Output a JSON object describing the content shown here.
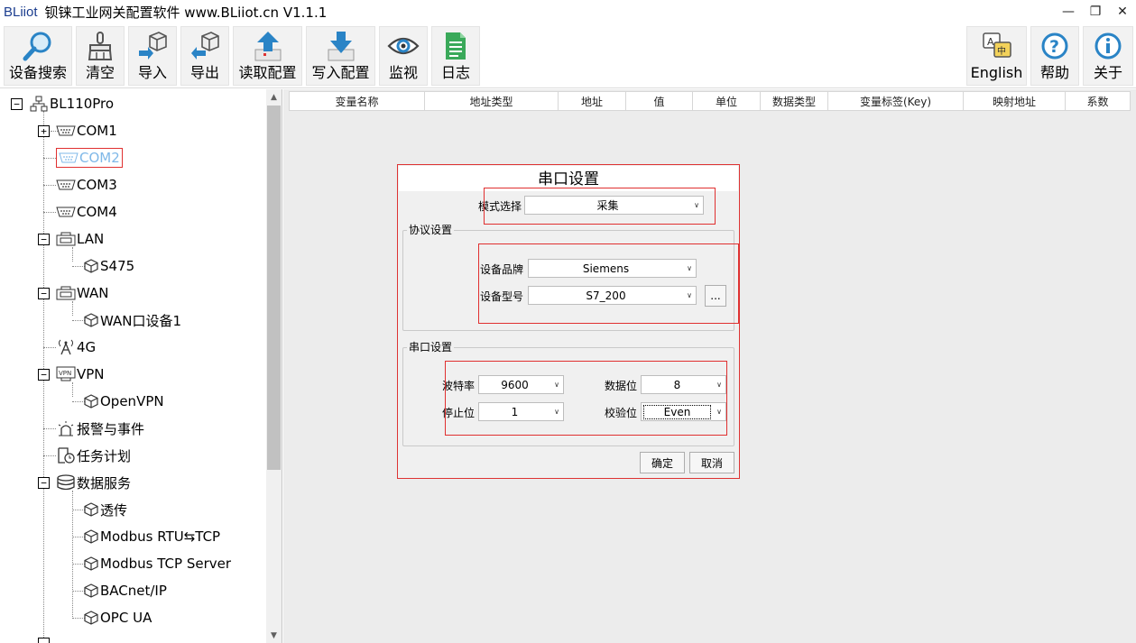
{
  "window": {
    "logo": "BLiiot",
    "title": "钡铼工业网关配置软件 www.BLiiot.cn V1.1.1",
    "minimize": "—",
    "restore": "❐",
    "close": "✕"
  },
  "toolbar": {
    "left": [
      {
        "label": "设备搜索",
        "icon": "magnifier-icon"
      },
      {
        "label": "清空",
        "icon": "broom-icon"
      },
      {
        "label": "导入",
        "icon": "import-box-icon"
      },
      {
        "label": "导出",
        "icon": "export-box-icon"
      },
      {
        "label": "读取配置",
        "icon": "upload-arrow-icon"
      },
      {
        "label": "写入配置",
        "icon": "download-arrow-icon"
      },
      {
        "label": "监视",
        "icon": "eye-icon"
      },
      {
        "label": "日志",
        "icon": "log-document-icon"
      }
    ],
    "right": [
      {
        "label": "English",
        "icon": "language-icon"
      },
      {
        "label": "帮助",
        "icon": "help-icon"
      },
      {
        "label": "关于",
        "icon": "info-icon"
      }
    ]
  },
  "tree": {
    "root": "BL110Pro",
    "items": [
      {
        "label": "COM1",
        "icon": "serial-port-icon"
      },
      {
        "label": "COM2",
        "icon": "serial-port-icon"
      },
      {
        "label": "COM3",
        "icon": "serial-port-icon"
      },
      {
        "label": "COM4",
        "icon": "serial-port-icon"
      },
      {
        "label": "LAN",
        "icon": "lan-port-icon"
      },
      {
        "label": "S475",
        "icon": "device-cube-icon"
      },
      {
        "label": "WAN",
        "icon": "wan-port-icon"
      },
      {
        "label": "WAN口设备1",
        "icon": "device-cube-icon"
      },
      {
        "label": "4G",
        "icon": "antenna-icon"
      },
      {
        "label": "VPN",
        "icon": "vpn-icon"
      },
      {
        "label": "OpenVPN",
        "icon": "device-cube-icon"
      },
      {
        "label": "报警与事件",
        "icon": "alarm-icon"
      },
      {
        "label": "任务计划",
        "icon": "schedule-icon"
      },
      {
        "label": "数据服务",
        "icon": "database-icon"
      },
      {
        "label": "透传",
        "icon": "device-cube-icon"
      },
      {
        "label": "Modbus RTU⇆TCP",
        "icon": "device-cube-icon"
      },
      {
        "label": "Modbus TCP Server",
        "icon": "device-cube-icon"
      },
      {
        "label": "BACnet/IP",
        "icon": "device-cube-icon"
      },
      {
        "label": "OPC UA",
        "icon": "device-cube-icon"
      }
    ]
  },
  "grid": {
    "columns": [
      "变量名称",
      "地址类型",
      "地址",
      "值",
      "单位",
      "数据类型",
      "变量标签(Key)",
      "映射地址",
      "系数"
    ]
  },
  "dialog": {
    "title": "串口设置",
    "mode_label": "模式选择",
    "mode_value": "采集",
    "protocol_group": "协议设置",
    "brand_label": "设备品牌",
    "brand_value": "Siemens",
    "model_label": "设备型号",
    "model_value": "S7_200",
    "more_button": "...",
    "serial_group": "串口设置",
    "baud_label": "波特率",
    "baud_value": "9600",
    "databits_label": "数据位",
    "databits_value": "8",
    "stopbits_label": "停止位",
    "stopbits_value": "1",
    "parity_label": "校验位",
    "parity_value": "Even",
    "ok": "确定",
    "cancel": "取消"
  },
  "colors": {
    "highlight_red": "#e03030",
    "selected_text": "#7fb8e8",
    "logo_blue": "#1b3d8f"
  }
}
